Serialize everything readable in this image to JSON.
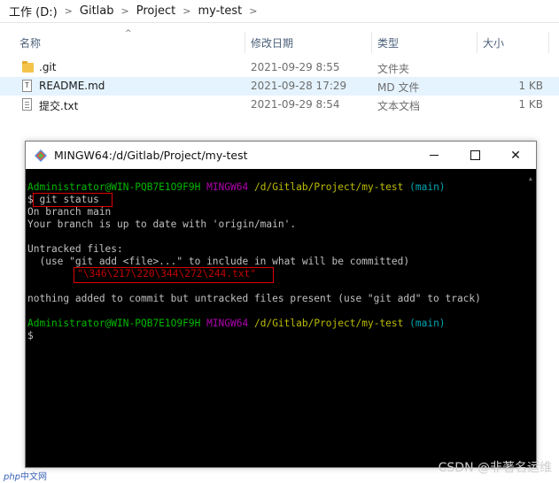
{
  "explorer": {
    "breadcrumb": [
      "工作 (D:)",
      "Gitlab",
      "Project",
      "my-test"
    ],
    "columns": {
      "name": "名称",
      "date": "修改日期",
      "type": "类型",
      "size": "大小"
    },
    "files": [
      {
        "name": ".git",
        "date": "2021-09-29 8:55",
        "type": "文件夹",
        "size": "",
        "icon": "folder-icon"
      },
      {
        "name": "README.md",
        "date": "2021-09-28 17:29",
        "type": "MD 文件",
        "size": "1 KB",
        "icon": "markdown-file-icon"
      },
      {
        "name": "提交.txt",
        "date": "2021-09-29 8:54",
        "type": "文本文档",
        "size": "1 KB",
        "icon": "text-file-icon"
      }
    ],
    "selected_row": 1
  },
  "terminal": {
    "title": "MINGW64:/d/Gitlab/Project/my-test",
    "prompt": {
      "user": "Administrator@WIN-PQB7E1O9F9H",
      "system": "MINGW64",
      "path": "/d/Gitlab/Project/my-test",
      "branch": "(main)"
    },
    "command": "git status",
    "output": {
      "line1": "On branch main",
      "line2": "Your branch is up to date with 'origin/main'.",
      "line3": "Untracked files:",
      "line4": "  (use \"git add <file>...\" to include in what will be committed)",
      "untracked_file": "\"\\346\\217\\220\\344\\272\\244.txt\"",
      "line5": "nothing added to commit but untracked files present (use \"git add\" to track)"
    },
    "prompt_symbol": "$",
    "colors": {
      "user": "#00b800",
      "system": "#b000b0",
      "path": "#bcbc00",
      "branch": "#00a6b2",
      "untracked": "#c00000",
      "highlight_box": "#e00000"
    }
  },
  "watermarks": {
    "php_prefix": "php",
    "php_suffix": "中文网",
    "csdn": "CSDN @非著名运维"
  }
}
